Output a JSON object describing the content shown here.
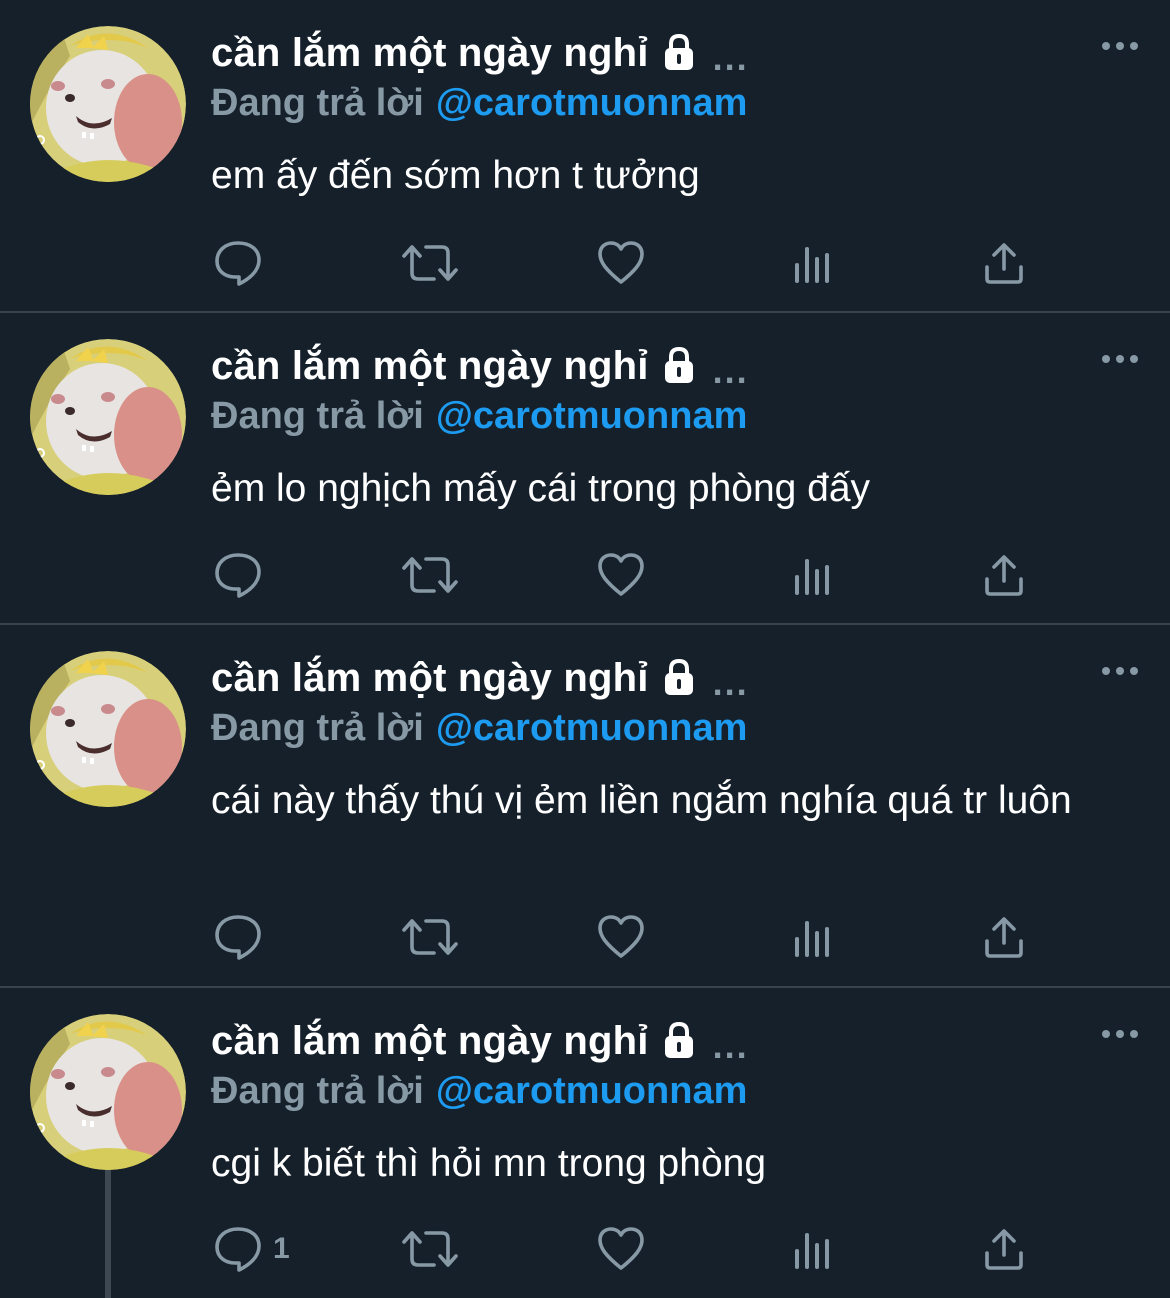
{
  "colors": {
    "background": "#15202b",
    "divider": "#38444d",
    "muted": "#8899a6",
    "accent": "#1d9bf0",
    "text": "#ffffff"
  },
  "tweets": [
    {
      "display_name": "cần lắm một ngày nghỉ",
      "name_suffix": "...",
      "reply_prefix": "Đang trả lời",
      "reply_handle": "@carotmuonnam",
      "text": "em ấy đến sớm hơn t tưởng",
      "reply_count": ""
    },
    {
      "display_name": "cần lắm một ngày nghỉ",
      "name_suffix": "...",
      "reply_prefix": "Đang trả lời",
      "reply_handle": "@carotmuonnam",
      "text": "ẻm lo nghịch mấy cái trong phòng đấy",
      "reply_count": ""
    },
    {
      "display_name": "cần lắm một ngày nghỉ",
      "name_suffix": "...",
      "reply_prefix": "Đang trả lời",
      "reply_handle": "@carotmuonnam",
      "text": "cái này thấy thú vị ẻm liền ngắm nghía quá tr luôn",
      "reply_count": ""
    },
    {
      "display_name": "cần lắm một ngày nghỉ",
      "name_suffix": "...",
      "reply_prefix": "Đang trả lời",
      "reply_handle": "@carotmuonnam",
      "text": "cgi k biết thì hỏi mn trong phòng",
      "reply_count": "1"
    }
  ],
  "icons": {
    "lock": "lock-icon",
    "more": "more-icon",
    "reply": "reply-icon",
    "retweet": "retweet-icon",
    "like": "heart-icon",
    "views": "views-icon",
    "share": "share-icon"
  }
}
